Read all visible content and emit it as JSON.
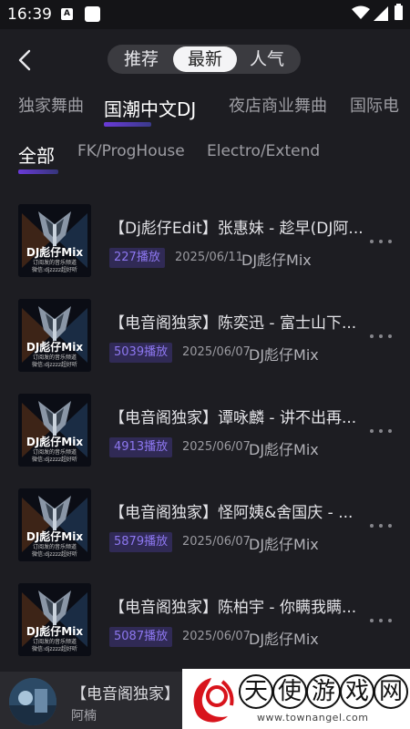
{
  "status_bar": {
    "time": "16:39",
    "notif_letter": "A"
  },
  "header": {
    "segments": [
      {
        "label": "推荐",
        "active": false
      },
      {
        "label": "最新",
        "active": true
      },
      {
        "label": "人气",
        "active": false
      }
    ]
  },
  "category_tabs": [
    {
      "label": "独家舞曲",
      "active": false
    },
    {
      "label": "国潮中文DJ",
      "active": true
    },
    {
      "label": "夜店商业舞曲",
      "active": false
    },
    {
      "label": "国际电",
      "active": false
    }
  ],
  "sub_tabs": [
    {
      "label": "全部",
      "active": true
    },
    {
      "label": "FK/ProgHouse",
      "active": false
    },
    {
      "label": "Electro/Extend",
      "active": false
    }
  ],
  "cover_art": {
    "line1": "DJ彪仔Mix",
    "line2": "订阅发的音乐频道",
    "line3": "微信:djzzzz超好听"
  },
  "tracks": [
    {
      "title": "【Dj彪仔Edit】张惠妹 - 趁早(DJ阿...",
      "plays": "227播放",
      "date": "2025/06/11",
      "artist": "DJ彪仔Mix"
    },
    {
      "title": "【电音阁独家】陈奕迅 - 富士山下...",
      "plays": "5039播放",
      "date": "2025/06/07",
      "artist": "DJ彪仔Mix"
    },
    {
      "title": "【电音阁独家】谭咏麟 - 讲不出再...",
      "plays": "4913播放",
      "date": "2025/06/07",
      "artist": "DJ彪仔Mix"
    },
    {
      "title": "【电音阁独家】怪阿姨&舍国庆 - ...",
      "plays": "5879播放",
      "date": "2025/06/07",
      "artist": "DJ彪仔Mix"
    },
    {
      "title": "【电音阁独家】陈柏宇 - 你瞒我瞒...",
      "plays": "5087播放",
      "date": "2025/06/07",
      "artist": "DJ彪仔Mix"
    }
  ],
  "mini_player": {
    "title": "【电音阁独家】",
    "artist": "阿楠"
  },
  "watermark": {
    "chars": [
      "天",
      "使",
      "游",
      "戏",
      "网"
    ],
    "url": "www.townangel.com"
  },
  "colors": {
    "background": "#1d1d22",
    "accent": "#6a3ad8",
    "badge_bg": "#302a55",
    "badge_text": "#8d77f0"
  }
}
